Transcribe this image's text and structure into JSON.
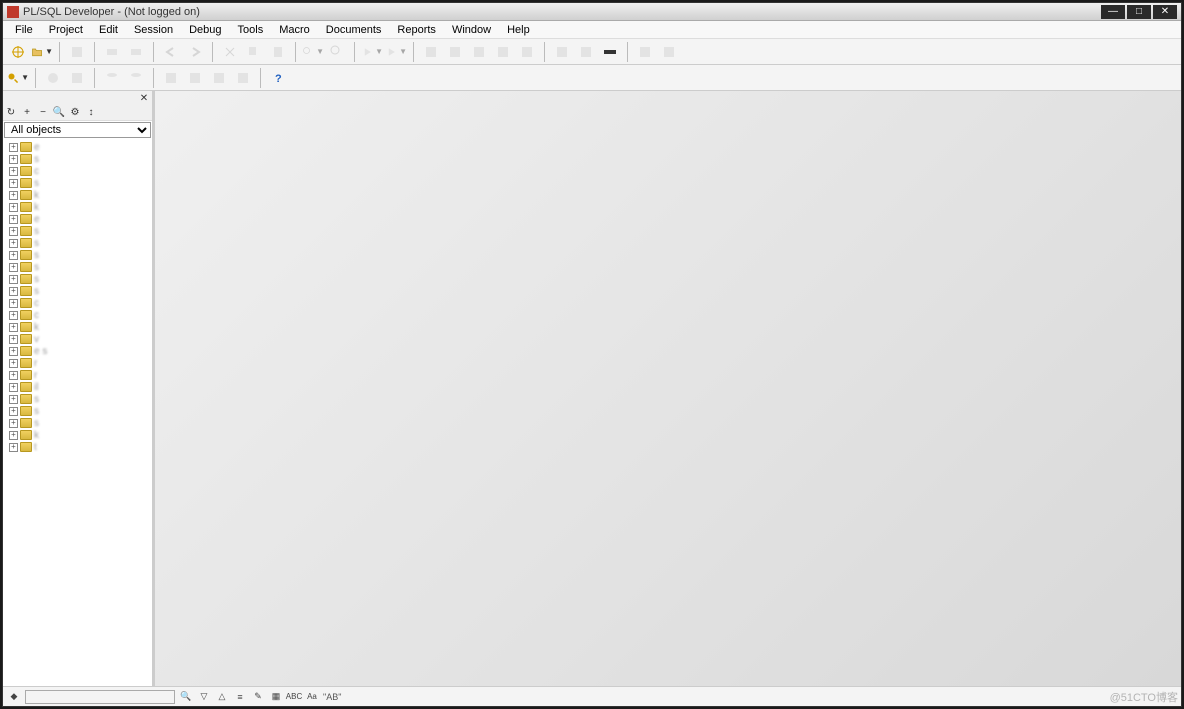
{
  "title": "PL/SQL Developer - (Not logged on)",
  "menu": [
    "File",
    "Project",
    "Edit",
    "Session",
    "Debug",
    "Tools",
    "Macro",
    "Documents",
    "Reports",
    "Window",
    "Help"
  ],
  "filter": "All objects",
  "tree_items": [
    {
      "label": "e"
    },
    {
      "label": "s"
    },
    {
      "label": "c"
    },
    {
      "label": "s"
    },
    {
      "label": "k"
    },
    {
      "label": "k"
    },
    {
      "label": "e"
    },
    {
      "label": "s"
    },
    {
      "label": "s"
    },
    {
      "label": "s"
    },
    {
      "label": "s"
    },
    {
      "label": "s"
    },
    {
      "label": "s"
    },
    {
      "label": "c"
    },
    {
      "label": "c"
    },
    {
      "label": "k"
    },
    {
      "label": "v"
    },
    {
      "label": "e           s"
    },
    {
      "label": "r"
    },
    {
      "label": "r"
    },
    {
      "label": "il"
    },
    {
      "label": "s"
    },
    {
      "label": "s"
    },
    {
      "label": "s"
    },
    {
      "label": "k"
    },
    {
      "label": "t"
    }
  ],
  "status_text": "\"AB\"",
  "watermark": "@51CTO博客"
}
